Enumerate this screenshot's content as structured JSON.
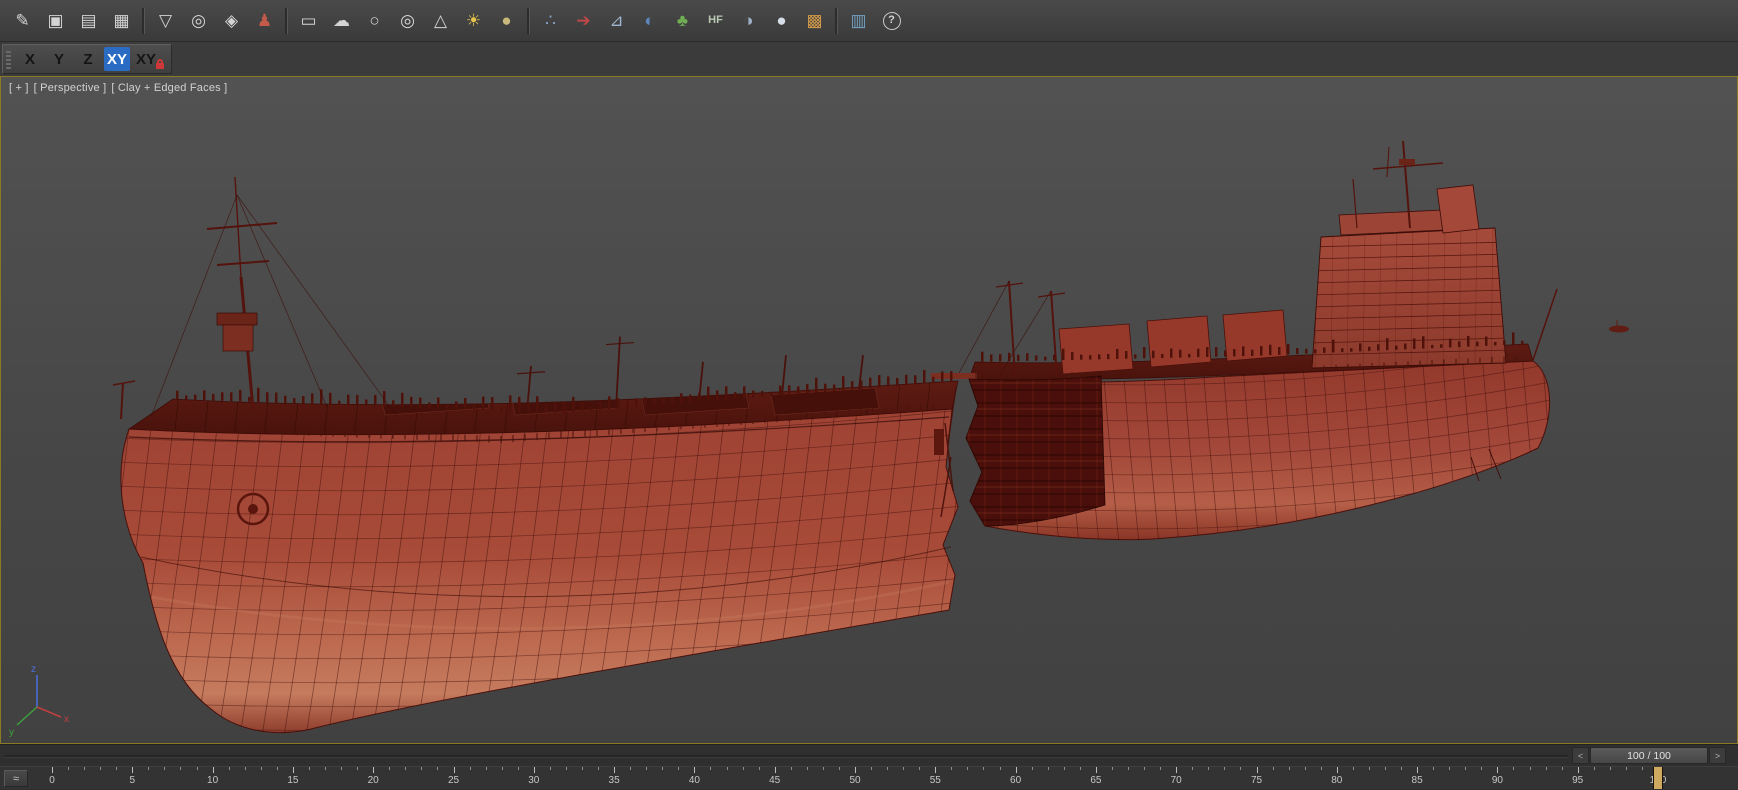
{
  "toolbar": {
    "icons": [
      {
        "name": "freehand-icon",
        "glyph": "✎"
      },
      {
        "name": "bitmap-icon",
        "glyph": "▣"
      },
      {
        "name": "notes-icon",
        "glyph": "▤"
      },
      {
        "name": "datasheet-icon",
        "glyph": "▦"
      },
      {
        "name": "separator",
        "glyph": "",
        "sep": true
      },
      {
        "name": "filter-icon",
        "glyph": "▽"
      },
      {
        "name": "dolly-camera-icon",
        "glyph": "◎"
      },
      {
        "name": "pan-camera-icon",
        "glyph": "◈"
      },
      {
        "name": "walkthrough-icon",
        "glyph": "♟",
        "color": "#c25a4a"
      },
      {
        "name": "separator",
        "glyph": "",
        "sep": true
      },
      {
        "name": "rectangle-icon",
        "glyph": "▭"
      },
      {
        "name": "cloud-icon",
        "glyph": "☁"
      },
      {
        "name": "circle-icon",
        "glyph": "○"
      },
      {
        "name": "donut-icon",
        "glyph": "◎"
      },
      {
        "name": "cone-icon",
        "glyph": "△"
      },
      {
        "name": "sun-icon",
        "glyph": "☀",
        "color": "#e6c44c"
      },
      {
        "name": "sphere-icon",
        "glyph": "●",
        "color": "#c8b87a"
      },
      {
        "name": "separator",
        "glyph": "",
        "sep": true
      },
      {
        "name": "scatter-icon",
        "glyph": "∴",
        "color": "#86a8cc"
      },
      {
        "name": "spacewarp-icon",
        "glyph": "➔",
        "color": "#c24848"
      },
      {
        "name": "protractor-icon",
        "glyph": "⊿",
        "color": "#9db6d2"
      },
      {
        "name": "earth-icon",
        "glyph": "◐",
        "color": "#5c88c0"
      },
      {
        "name": "foliage-icon",
        "glyph": "♣",
        "color": "#6fae52"
      },
      {
        "name": "hf-icon",
        "glyph": "HF",
        "color": "#b9c9b2"
      },
      {
        "name": "dark-sphere-icon",
        "glyph": "◑",
        "color": "#9db0c4"
      },
      {
        "name": "light-sphere-icon",
        "glyph": "●",
        "color": "#d5dde6"
      },
      {
        "name": "palette-icon",
        "glyph": "▩",
        "color": "#d29a4a"
      },
      {
        "name": "separator",
        "glyph": "",
        "sep": true
      },
      {
        "name": "schematic-icon",
        "glyph": "▥",
        "color": "#74a2c4"
      },
      {
        "name": "help-icon",
        "glyph": "?"
      }
    ]
  },
  "axis_toolbar": {
    "buttons": [
      {
        "label": "X",
        "active": false
      },
      {
        "label": "Y",
        "active": false
      },
      {
        "label": "Z",
        "active": false
      },
      {
        "label": "XY",
        "active": true
      }
    ],
    "lock_button": {
      "label": "XY"
    }
  },
  "viewport": {
    "label_plus": "[ + ]",
    "label_view": "[ Perspective ]",
    "label_shading": "[ Clay + Edged Faces ]",
    "axis_tripod": {
      "x": "x",
      "y": "y",
      "z": "z"
    }
  },
  "time_slider": {
    "value": "100 / 100",
    "prev_label": "<",
    "next_label": ">"
  },
  "track_bar": {
    "start": 0,
    "end": 100,
    "label_step": 5,
    "current_frame": 100
  },
  "colors": {
    "accent_blue": "#2a6cc4",
    "viewport_border": "#8a7a22",
    "ship_red": "#a84a38",
    "marker_tan": "#cfa95f"
  }
}
